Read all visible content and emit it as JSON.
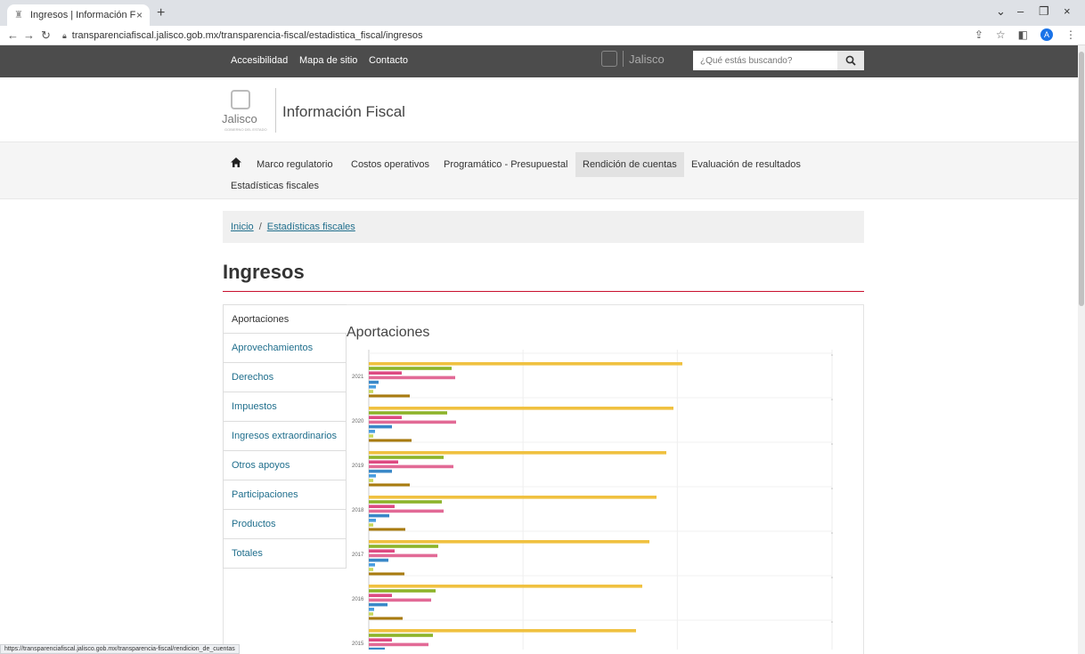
{
  "browser": {
    "tab_title": "Ingresos | Información Fiscal",
    "url": "transparenciafiscal.jalisco.gob.mx/transparencia-fiscal/estadistica_fiscal/ingresos",
    "status_url": "https://transparenciafiscal.jalisco.gob.mx/transparencia-fiscal/rendicion_de_cuentas",
    "profile_initial": "A"
  },
  "topbar": {
    "links": [
      "Accesibilidad",
      "Mapa de sitio",
      "Contacto"
    ],
    "logo_text": "Jalisco",
    "search_placeholder": "¿Qué estás buscando?"
  },
  "header": {
    "logo_word": "Jalisco",
    "logo_sub": "GOBIERNO DEL ESTADO",
    "site_title": "Información Fiscal"
  },
  "nav": {
    "items": [
      "Marco regulatorio",
      "Costos operativos",
      "Programático - Presupuestal",
      "Rendición de cuentas",
      "Evaluación de resultados",
      "Estadísticas fiscales"
    ],
    "active": "Rendición de cuentas"
  },
  "breadcrumb": {
    "home": "Inicio",
    "current": "Estadísticas fiscales"
  },
  "page": {
    "title": "Ingresos"
  },
  "tabs": {
    "items": [
      "Aportaciones",
      "Aprovechamientos",
      "Derechos",
      "Impuestos",
      "Ingresos extraordinarios",
      "Otros apoyos",
      "Participaciones",
      "Productos",
      "Totales"
    ],
    "active": "Aportaciones"
  },
  "colors": {
    "topbar": "#4c4c4c",
    "link": "#1f6e8c",
    "rule": "#c8102e"
  },
  "chart_data": {
    "type": "bar",
    "orientation": "horizontal",
    "title": "Aportaciones",
    "categories": [
      "2021",
      "2020",
      "2019",
      "2018",
      "2017",
      "2016",
      "2015"
    ],
    "series": [
      {
        "color": "#f0c140",
        "values": [
          352,
          342,
          334,
          323,
          315,
          307,
          300
        ]
      },
      {
        "color": "#8db42a",
        "values": [
          93,
          88,
          84,
          82,
          78,
          75,
          72
        ]
      },
      {
        "color": "#dd4a82",
        "values": [
          37,
          37,
          33,
          29,
          29,
          26,
          26
        ]
      },
      {
        "color": "#e26a96",
        "values": [
          97,
          98,
          95,
          84,
          77,
          70,
          67
        ]
      },
      {
        "color": "#3a88c8",
        "values": [
          11,
          26,
          26,
          23,
          22,
          21,
          18
        ]
      },
      {
        "color": "#4a9ee0",
        "values": [
          8,
          7,
          8,
          8,
          7,
          6,
          6
        ]
      },
      {
        "color": "#c9d85e",
        "values": [
          5,
          5,
          5,
          5,
          5,
          5,
          5
        ]
      },
      {
        "color": "#a87b10",
        "values": [
          46,
          48,
          46,
          41,
          40,
          38,
          36
        ]
      }
    ],
    "xlim": [
      0,
      520
    ]
  }
}
